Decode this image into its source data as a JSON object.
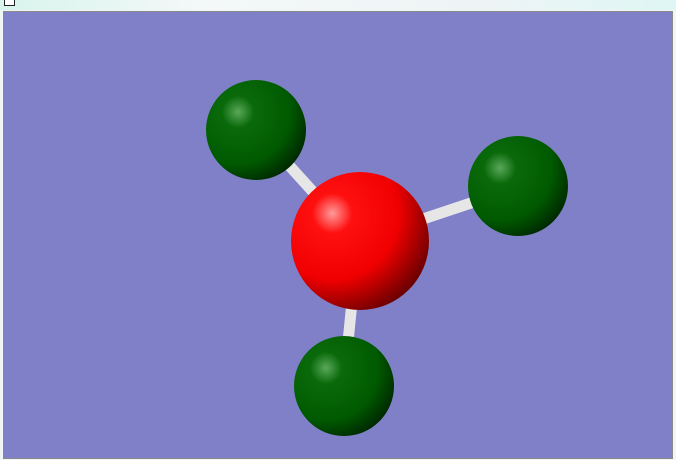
{
  "colors": {
    "background": "#8080c8",
    "central_atom": "#ff0000",
    "ligand_atom": "#006400",
    "bond": "#e0e0e0"
  },
  "molecule": {
    "atoms": [
      {
        "element": "central",
        "color": "#ff0000"
      },
      {
        "element": "ligand",
        "color": "#006400"
      },
      {
        "element": "ligand",
        "color": "#006400"
      },
      {
        "element": "ligand",
        "color": "#006400"
      }
    ]
  }
}
